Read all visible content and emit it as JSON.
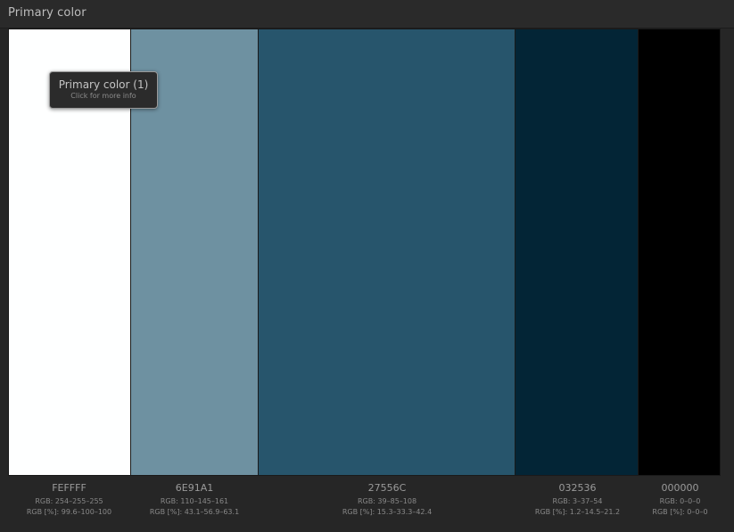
{
  "window": {
    "title": "Primary color"
  },
  "tooltip": {
    "title": "Primary color (1)",
    "subtitle": "Click for more info"
  },
  "swatches": [
    {
      "hex": "FEFFFF",
      "color": "#FEFFFF",
      "rgb": "RGB: 254–255–255",
      "rgb_pct": "RGB [%]: 99.6–100–100"
    },
    {
      "hex": "6E91A1",
      "color": "#6E91A1",
      "rgb": "RGB: 110–145–161",
      "rgb_pct": "RGB [%]: 43.1–56.9–63.1"
    },
    {
      "hex": "27556C",
      "color": "#27556C",
      "rgb": "RGB: 39–85–108",
      "rgb_pct": "RGB [%]: 15.3–33.3–42.4"
    },
    {
      "hex": "032536",
      "color": "#032536",
      "rgb": "RGB: 3–37–54",
      "rgb_pct": "RGB [%]: 1.2–14.5–21.2"
    },
    {
      "hex": "000000",
      "color": "#000000",
      "rgb": "RGB: 0–0–0",
      "rgb_pct": "RGB [%]: 0–0–0"
    }
  ]
}
